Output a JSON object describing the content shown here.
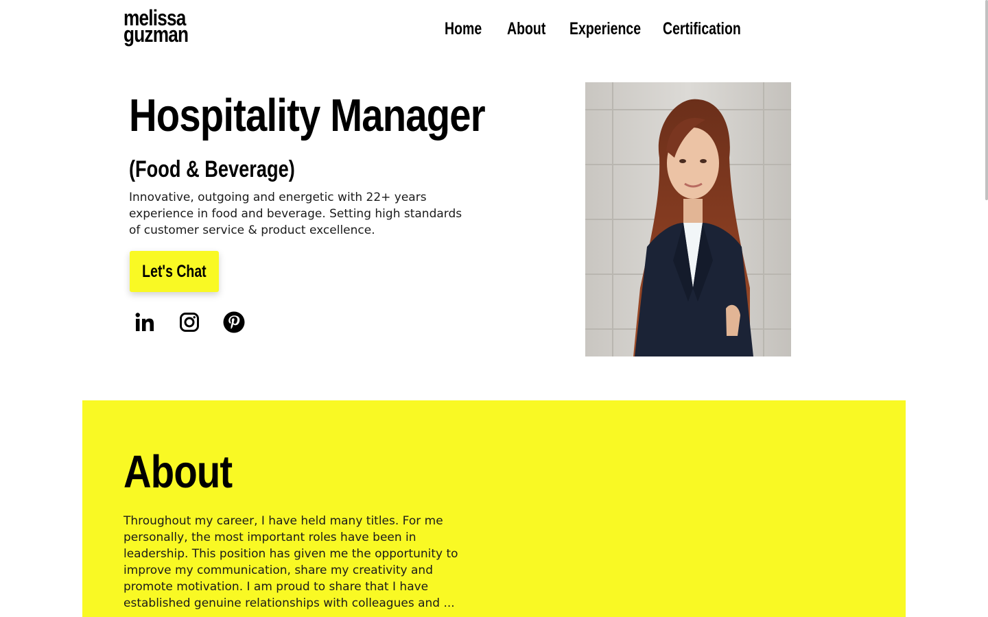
{
  "header": {
    "logo_line1": "melissa",
    "logo_line2": "guzman",
    "nav": [
      {
        "label": "Home"
      },
      {
        "label": "About"
      },
      {
        "label": "Experience"
      },
      {
        "label": "Certification"
      }
    ]
  },
  "hero": {
    "title": "Hospitality Manager",
    "subtitle": "(Food & Beverage)",
    "description": "Innovative, outgoing and energetic with 22+ years experience in food and beverage. Setting high standards of customer service & product excellence.",
    "cta_label": "Let's Chat",
    "social_icons": [
      "linkedin-icon",
      "instagram-icon",
      "pinterest-icon"
    ]
  },
  "about": {
    "title": "About",
    "text": "Throughout my career, I have held many titles. For me personally, the most important roles have been in leadership. This position has given me the opportunity to improve my communication, share my creativity and promote motivation. I am proud to share that I have established genuine relationships with colleagues and ..."
  },
  "colors": {
    "accent_yellow": "#f9f924",
    "text": "#000000",
    "background": "#ffffff"
  }
}
